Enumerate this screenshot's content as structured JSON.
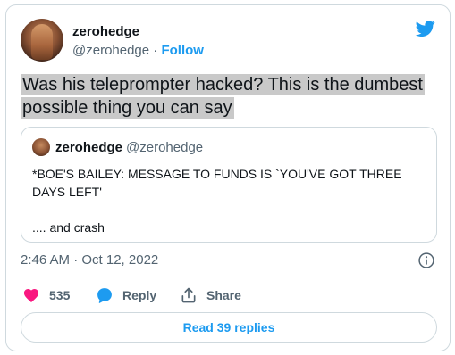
{
  "author": {
    "name": "zerohedge",
    "handle": "@zerohedge",
    "separator": "·",
    "follow_label": "Follow"
  },
  "tweet": {
    "text": "Was his teleprompter hacked? This is the dumbest possible thing you can say",
    "timestamp": "2:46 AM · Oct 12, 2022"
  },
  "quoted_tweet": {
    "name": "zerohedge",
    "handle": "@zerohedge",
    "text": "*BOE'S BAILEY: MESSAGE TO FUNDS IS `YOU'VE GOT THREE DAYS LEFT'\n\n.... and crash"
  },
  "actions": {
    "likes_count": "535",
    "reply_label": "Reply",
    "share_label": "Share"
  },
  "read_replies_label": "Read 39 replies",
  "colors": {
    "accent": "#1d9bf0",
    "like": "#f91880",
    "muted": "#536471",
    "highlight": "#c9c9c9"
  },
  "icons": [
    "twitter-bird-icon",
    "info-icon",
    "heart-icon",
    "reply-bubble-icon",
    "share-icon"
  ]
}
